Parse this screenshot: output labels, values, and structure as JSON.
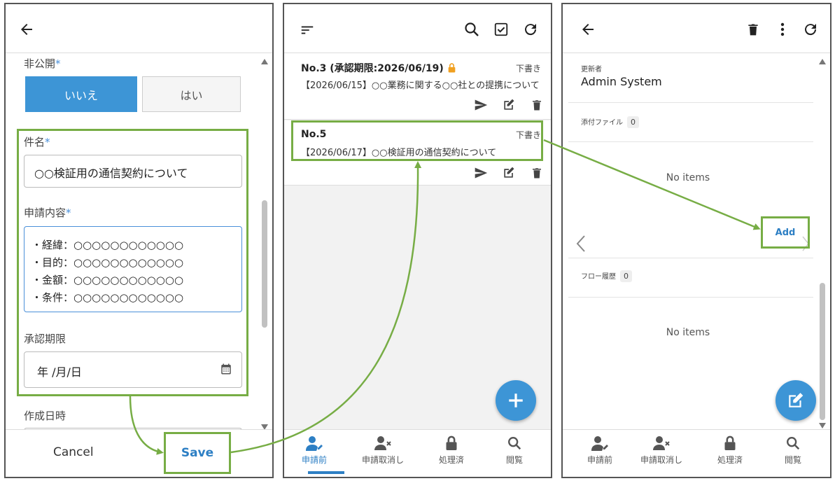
{
  "panel1": {
    "private_label": "非公開",
    "required_mark": "*",
    "private_options": [
      "いいえ",
      "はい"
    ],
    "subject_label": "件名",
    "subject_value": "○○検証用の通信契約について",
    "content_label": "申請内容",
    "content_lines": [
      "・経緯：○○○○○○○○○○○○",
      "・目的：○○○○○○○○○○○○",
      "・金額：○○○○○○○○○○○○",
      "・条件：○○○○○○○○○○○○"
    ],
    "deadline_label": "承認期限",
    "deadline_placeholder": "年 /月/日",
    "created_label": "作成日時",
    "cancel_label": "Cancel",
    "save_label": "Save"
  },
  "panel2": {
    "cards": [
      {
        "title": "No.3 (承認期限:2026/06/19)",
        "status": "下書き",
        "subject": "【2026/06/15】○○業務に関する○○社との提携について"
      },
      {
        "title": "No.5",
        "status": "下書き",
        "subject": "【2026/06/17】○○検証用の通信契約について"
      }
    ],
    "nav": [
      "申請前",
      "申請取消し",
      "処理済",
      "閲覧"
    ]
  },
  "panel3": {
    "updater_label": "更新者",
    "updater_value": "Admin System",
    "attach_label": "添付ファイル",
    "attach_count": "0",
    "no_items_1": "No items",
    "add_label": "Add",
    "flow_label": "フロー履歴",
    "flow_count": "0",
    "no_items_2": "No items",
    "nav": [
      "申請前",
      "申請取消し",
      "処理済",
      "閲覧"
    ]
  },
  "colors": {
    "accent": "#3d95d6",
    "highlight": "#77ad45",
    "lock": "#f0a020"
  }
}
